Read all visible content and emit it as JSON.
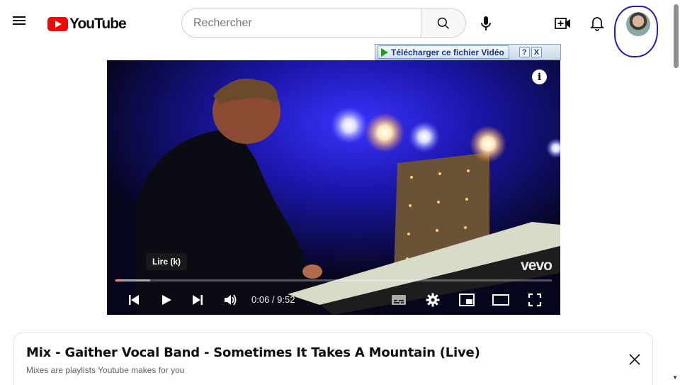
{
  "header": {
    "logo_text": "YouTube",
    "search_placeholder": "Rechercher",
    "icons": [
      "menu-icon",
      "search-icon",
      "mic-icon",
      "create-video-icon",
      "bell-icon",
      "avatar"
    ]
  },
  "download_bar": {
    "label": "Télécharger ce fichier Vidéo",
    "help": "?",
    "close": "X"
  },
  "player": {
    "watermark": "vevo",
    "info_glyph": "i",
    "tooltip": "Lire (k)",
    "time": "0:06 / 9:52",
    "progress_fraction": 0.0102,
    "buffered_fraction": 0.08
  },
  "mix": {
    "title": "Mix - Gaither Vocal Band - Sometimes It Takes A Mountain (Live)",
    "subtitle": "Mixes are playlists Youtube makes for you"
  },
  "colors": {
    "brand_red": "#ff0000",
    "annotation_blue": "#1f1fb5",
    "player_bg": "#07072a"
  }
}
